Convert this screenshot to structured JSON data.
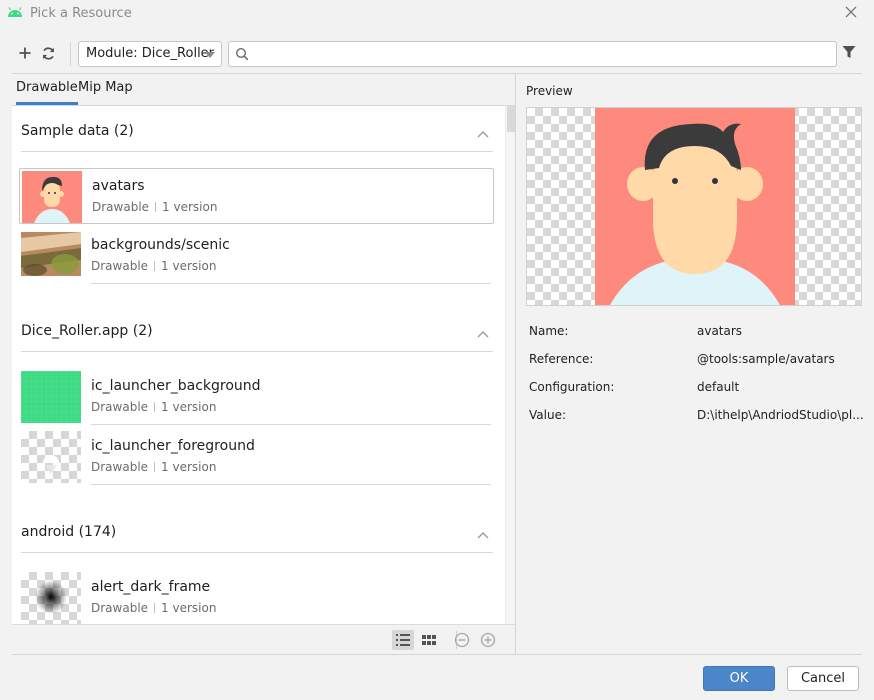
{
  "window": {
    "title": "Pick a Resource"
  },
  "toolbar": {
    "module_label": "Module: Dice_Roller",
    "search_placeholder": "",
    "icons": [
      "add-icon",
      "refresh-icon",
      "search-icon",
      "filter-icon"
    ]
  },
  "tabs": [
    {
      "label": "Drawable",
      "active": true
    },
    {
      "label": "Mip Map",
      "active": false
    }
  ],
  "sections": [
    {
      "label": "Sample data (2)",
      "items": [
        {
          "name": "avatars",
          "type": "Drawable",
          "versions": "1 version",
          "selected": true
        },
        {
          "name": "backgrounds/scenic",
          "type": "Drawable",
          "versions": "1 version",
          "selected": false
        }
      ]
    },
    {
      "label": "Dice_Roller.app (2)",
      "items": [
        {
          "name": "ic_launcher_background",
          "type": "Drawable",
          "versions": "1 version",
          "selected": false
        },
        {
          "name": "ic_launcher_foreground",
          "type": "Drawable",
          "versions": "1 version",
          "selected": false
        }
      ]
    },
    {
      "label": "android (174)",
      "items": [
        {
          "name": "alert_dark_frame",
          "type": "Drawable",
          "versions": "1 version",
          "selected": false
        }
      ]
    }
  ],
  "preview": {
    "label": "Preview",
    "props": [
      {
        "key": "Name:",
        "value": "avatars"
      },
      {
        "key": "Reference:",
        "value": "@tools:sample/avatars"
      },
      {
        "key": "Configuration:",
        "value": "default"
      },
      {
        "key": "Value:",
        "value": "D:\\ithelp\\AndriodStudio\\pl..."
      }
    ]
  },
  "footer": {
    "ok_label": "OK",
    "cancel_label": "Cancel"
  },
  "colors": {
    "accent": "#4a86c8",
    "tab_underline": "#3d7fc4",
    "avatar_bg": "#fe8a7e",
    "launcher_green": "#3ddc84"
  }
}
